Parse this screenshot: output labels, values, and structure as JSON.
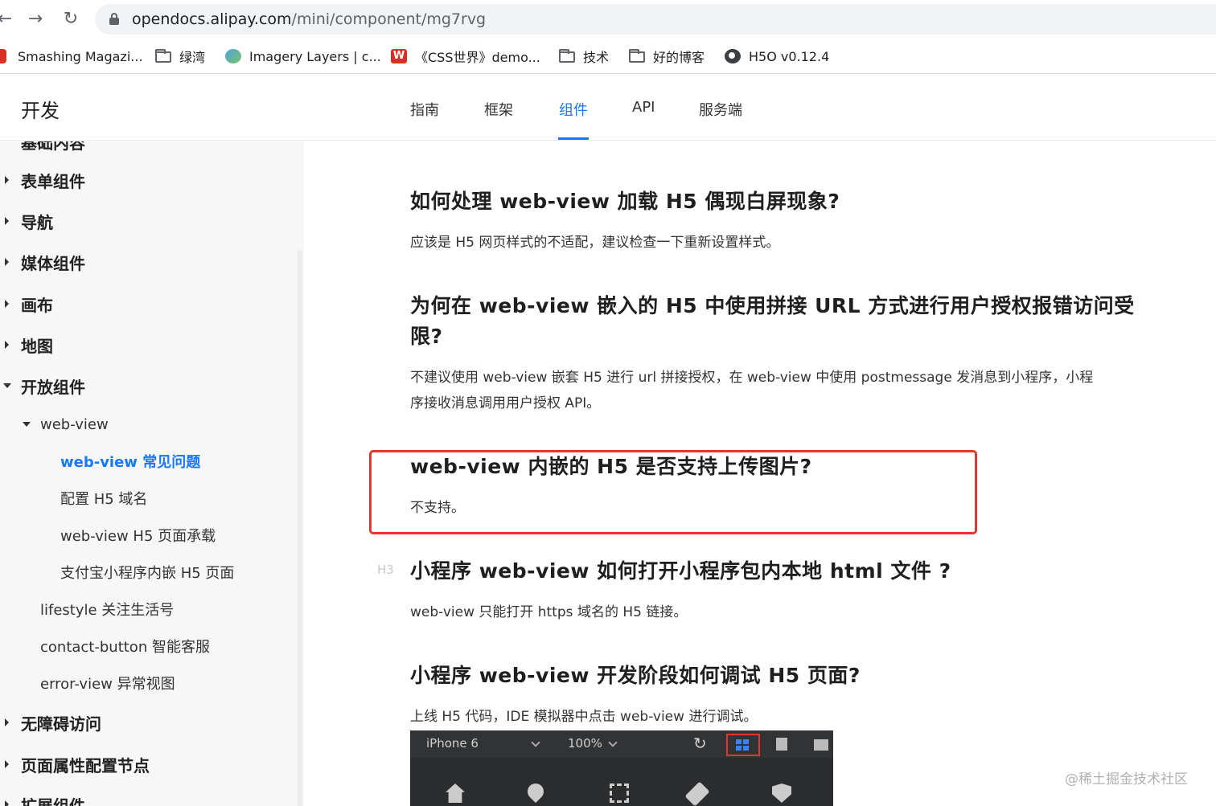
{
  "browser": {
    "back_icon": "arrow-left",
    "forward_icon": "arrow-right",
    "reload_icon": "reload",
    "url_host": "opendocs.alipay.com",
    "url_path": "/mini/component/mg7rvg",
    "bookmarks": [
      {
        "label": "Smashing Magazi...",
        "icon": "smashing-logo"
      },
      {
        "label": "绿湾",
        "icon": "folder"
      },
      {
        "label": "Imagery Layers | c...",
        "icon": "imagery-logo"
      },
      {
        "label": "《CSS世界》demo...",
        "icon": "css-world-logo"
      },
      {
        "label": "技术",
        "icon": "folder"
      },
      {
        "label": "好的博客",
        "icon": "folder"
      },
      {
        "label": "H5O v0.12.4",
        "icon": "globe"
      }
    ]
  },
  "header": {
    "logo": "开发",
    "tabs": [
      {
        "label": "指南"
      },
      {
        "label": "框架"
      },
      {
        "label": "组件",
        "active": true
      },
      {
        "label": "API"
      },
      {
        "label": "服务端"
      }
    ],
    "accent": "#1677ff"
  },
  "sidebar": {
    "partial_item": "基础内容",
    "groups": [
      {
        "label": "表单组件"
      },
      {
        "label": "导航"
      },
      {
        "label": "媒体组件"
      },
      {
        "label": "画布"
      },
      {
        "label": "地图"
      },
      {
        "label": "开放组件",
        "expanded": true
      }
    ],
    "webview_label": "web-view",
    "webview_children": [
      {
        "label": "web-view 常见问题",
        "active": true
      },
      {
        "label": "配置 H5 域名"
      },
      {
        "label": "web-view H5 页面承载"
      },
      {
        "label": "支付宝小程序内嵌 H5 页面"
      }
    ],
    "open_children": [
      {
        "label": "lifestyle 关注生活号"
      },
      {
        "label": "contact-button 智能客服"
      },
      {
        "label": "error-view 异常视图"
      }
    ],
    "groups_after": [
      {
        "label": "无障碍访问"
      },
      {
        "label": "页面属性配置节点"
      },
      {
        "label": "扩展组件"
      }
    ]
  },
  "content": {
    "faq": [
      {
        "q": "如何处理 web-view 加载 H5 偶现白屏现象?",
        "a": "应该是 H5 网页样式的不适配，建议检查一下重新设置样式。"
      },
      {
        "q1": "为何在 web-view 嵌入的 H5 中使用拼接 URL 方式进行用户授权报错访问受",
        "q2": "限?",
        "a1": "不建议使用 web-view 嵌套 H5 进行 url 拼接授权，在 web-view 中使用 postmessage 发消息到小程序，小程",
        "a2": "序接收消息调用用户授权 API。"
      },
      {
        "q": "web-view 内嵌的 H5 是否支持上传图片?",
        "a": "不支持。"
      },
      {
        "q": "小程序 web-view 如何打开小程序包内本地 html 文件 ?",
        "a": "web-view 只能打开 https 域名的 H5 链接。"
      },
      {
        "q": "小程序 web-view 开发阶段如何调试 H5 页面?",
        "a": "上线 H5 代码，IDE 模拟器中点击 web-view 进行调试。"
      }
    ],
    "h3_tag": "H3",
    "highlight_color": "#e0382f",
    "ide": {
      "device": "iPhone 6",
      "zoom": "100%"
    }
  },
  "watermark": "@稀土掘金技术社区"
}
